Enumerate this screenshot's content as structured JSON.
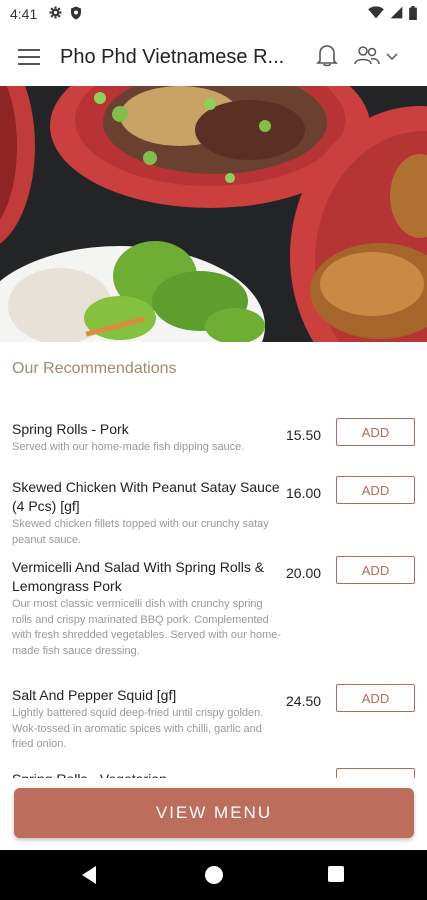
{
  "status_bar": {
    "time": "4:41",
    "left_icons": [
      "gear-icon",
      "shield-icon"
    ],
    "right_icons": [
      "wifi-icon",
      "signal-icon",
      "battery-icon"
    ]
  },
  "app_bar": {
    "title": "Pho Phd Vietnamese R...",
    "icons": [
      "hamburger-menu-icon",
      "bell-icon",
      "user-group-icon",
      "chevron-down-icon"
    ]
  },
  "section": {
    "title": "Our Recommendations"
  },
  "menu_items": [
    {
      "name": "Spring Rolls - Pork",
      "description": "Served with our home-made fish dipping sauce.",
      "price": "15.50",
      "button": "ADD"
    },
    {
      "name": "Skewed Chicken With Peanut Satay Sauce (4 Pcs) [gf]",
      "description": "Skewed chicken fillets topped with our crunchy satay peanut sauce.",
      "price": "16.00",
      "button": "ADD"
    },
    {
      "name": "Vermicelli And Salad With Spring Rolls & Lemongrass Pork",
      "description": "Our most classic vermicelli dish with crunchy spring rolls and crispy marinated BBQ pork. Complemented with fresh shredded vegetables. Served with our home-made fish sauce dressing.",
      "price": "20.00",
      "button": "ADD"
    },
    {
      "name": "Salt And Pepper Squid [gf]",
      "description": "Lightly battered squid deep-fried until crispy golden. Wok-tossed in aromatic spices with chilli, garlic and fried onion.",
      "price": "24.50",
      "button": "ADD"
    },
    {
      "name": "Spring Rolls - Vegetarian",
      "description": "",
      "price": "",
      "button": "ADD"
    }
  ],
  "view_menu": {
    "label": "VIEW MENU"
  },
  "colors": {
    "accent": "#bc6d5c",
    "section_title": "#a4896a",
    "add_border": "#b46a58"
  }
}
